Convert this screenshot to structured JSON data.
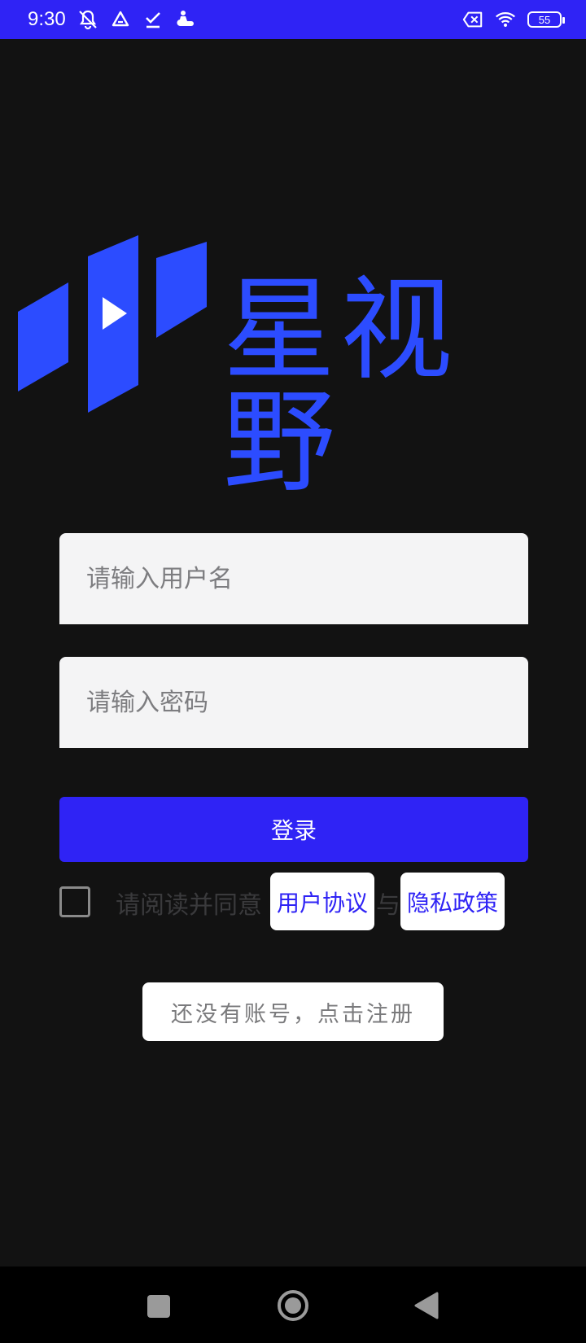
{
  "status_bar": {
    "time": "9:30",
    "battery_level": "55",
    "icons": [
      "muted-bell-icon",
      "drive-icon",
      "check-icon",
      "pet-icon",
      "no-sim-icon",
      "wifi-icon",
      "battery-icon"
    ]
  },
  "logo": {
    "text": "星视野",
    "color": "#2c4cff"
  },
  "form": {
    "username_placeholder": "请输入用户名",
    "username_value": "",
    "password_placeholder": "请输入密码",
    "password_value": "",
    "login_label": "登录"
  },
  "agreement": {
    "prefix": "请阅读并同意",
    "user_agreement": "用户协议",
    "conjunction": "与",
    "privacy_policy": "隐私政策",
    "checked": false
  },
  "register": {
    "label": "还没有账号，点击注册"
  },
  "colors": {
    "accent": "#2f23f5",
    "background": "#121212",
    "logo_blue": "#2c4cff"
  }
}
